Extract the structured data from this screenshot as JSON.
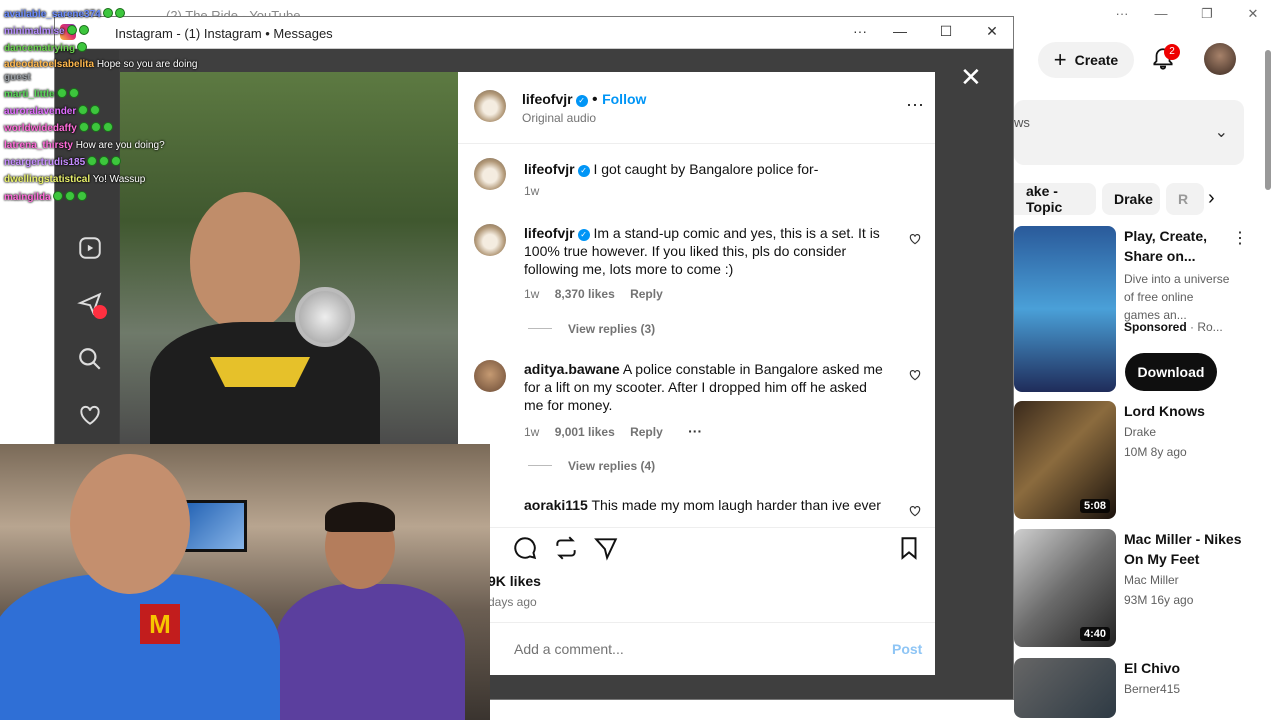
{
  "youtube": {
    "tab_title": "(2) The Ride - YouTube",
    "create_label": "Create",
    "notif_count": "2",
    "dropdown_text": "ws",
    "chips": [
      "ake - Topic",
      "Drake",
      "R"
    ],
    "ad": {
      "title": "Play, Create, Share on...",
      "desc": "Dive into a universe of free online games an...",
      "sponsored": "Sponsored",
      "advertiser": "Ro...",
      "cta": "Download"
    },
    "videos": [
      {
        "title": "Lord Knows",
        "channel": "Drake",
        "stats": "10M  8y ago",
        "duration": "5:08"
      },
      {
        "title": "Mac Miller - Nikes On My Feet",
        "channel": "Mac Miller",
        "stats": "93M  16y ago",
        "duration": "4:40"
      },
      {
        "title": "El Chivo",
        "channel": "Berner415",
        "stats": "",
        "duration": ""
      }
    ]
  },
  "instagram": {
    "window_title": "Instagram - (1) Instagram • Messages",
    "post": {
      "author": "lifeofvjr",
      "follow": "Follow",
      "audio": "Original audio",
      "caption_user": "lifeofvjr",
      "caption": "I got caught by Bangalore police for-",
      "caption_age": "1w"
    },
    "comments": [
      {
        "user": "lifeofvjr",
        "verified": true,
        "text": "Im a stand-up comic and yes, this is a set. It is 100% true however. If you liked this, pls do consider following me, lots more to come :)",
        "age": "1w",
        "likes": "8,370 likes",
        "reply": "Reply",
        "view_replies": "View replies (3)"
      },
      {
        "user": "aditya.bawane",
        "verified": false,
        "text": "A police constable in Bangalore asked me for a lift on my scooter. After I dropped him off he asked me for money.",
        "age": "1w",
        "likes": "9,001 likes",
        "reply": "Reply",
        "view_replies": "View replies (4)"
      },
      {
        "user": "aoraki115",
        "verified": false,
        "text": "This made my mom laugh harder than ive ever"
      }
    ],
    "likes_line": "9K likes",
    "age_line": "days ago",
    "add_comment_placeholder": "Add a comment...",
    "post_button": "Post"
  },
  "chat": [
    {
      "user": "available_sarene374",
      "msg": "",
      "color": "#6b8cff"
    },
    {
      "user": "minimalmise",
      "msg": "",
      "color": "#b58cff"
    },
    {
      "user": "dancematrying",
      "msg": "",
      "color": "#6bd14f"
    },
    {
      "user": "adeodatoelsabelita",
      "msg": "Hope so you are doing",
      "color": "#ffb84d"
    },
    {
      "user": "guest",
      "msg": "",
      "color": "#9aa0a6"
    },
    {
      "user": "marti_little",
      "msg": "",
      "color": "#59d659"
    },
    {
      "user": "auroralavender",
      "msg": "",
      "color": "#e06cff"
    },
    {
      "user": "worldwidedaffy",
      "msg": "",
      "color": "#ff6cd9"
    },
    {
      "user": "latrena_thirsty",
      "msg": "How are you doing?",
      "color": "#ff6cd9"
    },
    {
      "user": "neargertrudis185",
      "msg": "",
      "color": "#c58cff"
    },
    {
      "user": "dwellingstatistical",
      "msg": "Yo! Wassup",
      "color": "#e8f06b"
    },
    {
      "user": "maingilda",
      "msg": "",
      "color": "#ff6cd9"
    }
  ]
}
